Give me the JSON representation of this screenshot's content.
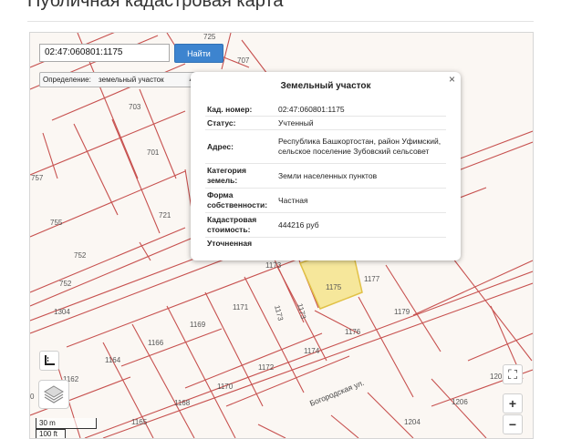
{
  "page": {
    "title": "Публичная кадастровая карта"
  },
  "search": {
    "value": "02:47:060801:1175",
    "button_label": "Найти"
  },
  "definition": {
    "label": "Определение:",
    "selected": "земельный участок"
  },
  "popup": {
    "title": "Земельный участок",
    "close": "×",
    "rows": [
      {
        "key": "Кад. номер:",
        "value": "02:47:060801:1175"
      },
      {
        "key": "Статус:",
        "value": "Учтенный"
      },
      {
        "key": "Адрес:",
        "value": "Республика Башкортостан, район Уфимский, сельское поселение Зубовский сельсовет"
      },
      {
        "key": "Категория земель:",
        "value": "Земли населенных пунктов"
      },
      {
        "key": "Форма собственности:",
        "value": "Частная"
      },
      {
        "key": "Кадастровая стоимость:",
        "value": "444216 руб"
      },
      {
        "key": "Уточненная",
        "value": ""
      }
    ]
  },
  "map": {
    "street": "Богородская ул.",
    "selected_parcel": "1175",
    "parcel_labels": [
      "725",
      "707",
      "703",
      "701",
      "757",
      "721",
      "755",
      "752",
      "752",
      "1304",
      "1173",
      "1173",
      "1173",
      "1175",
      "1177",
      "1171",
      "1179",
      "1169",
      "1176",
      "1166",
      "1174",
      "1164",
      "1172",
      "1162",
      "1170",
      "1168",
      "1206",
      "1165",
      "1204",
      "120",
      "0"
    ]
  },
  "controls": {
    "fullscreen_icon": "⛶",
    "zoom_in": "+",
    "zoom_out": "−",
    "scale_metric": "30 m",
    "scale_imperial": "100 ft"
  },
  "colors": {
    "parcel_line": "#c7514f",
    "selected_fill": "#f6e79b",
    "selected_stroke": "#e1c146",
    "button": "#3d84cf"
  }
}
